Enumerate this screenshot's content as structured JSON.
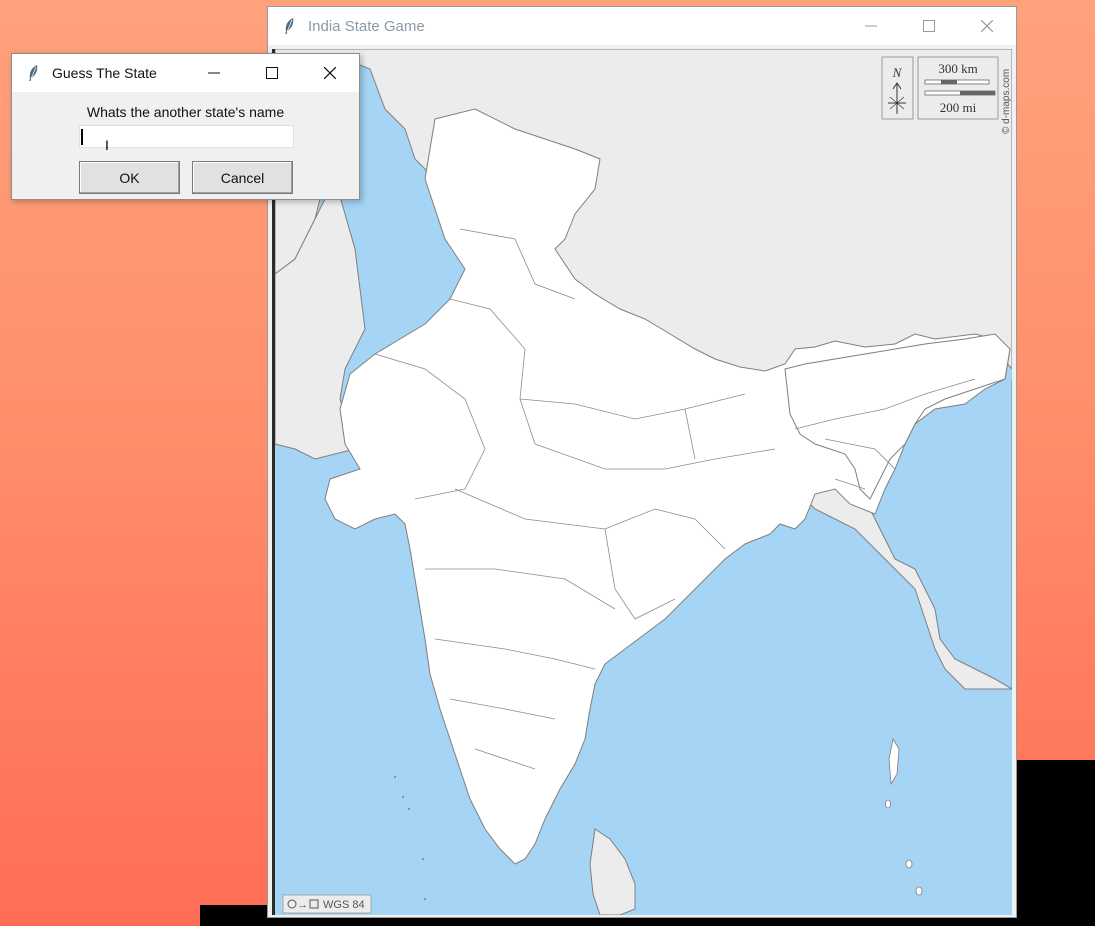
{
  "main_window": {
    "title": "India State Game",
    "map": {
      "compass_label": "N",
      "scale_km": "300 km",
      "scale_mi": "200 mi",
      "credit": "© d-maps.com",
      "projection": "WGS 84",
      "colors": {
        "sea": "#a5d4f5",
        "land": "#ffffff",
        "neighbor": "#ececec",
        "border": "#7f7f7f"
      }
    }
  },
  "dialog": {
    "title": "Guess The State",
    "prompt": "Whats the another state's name",
    "input_value": "",
    "ok_label": "OK",
    "cancel_label": "Cancel"
  }
}
